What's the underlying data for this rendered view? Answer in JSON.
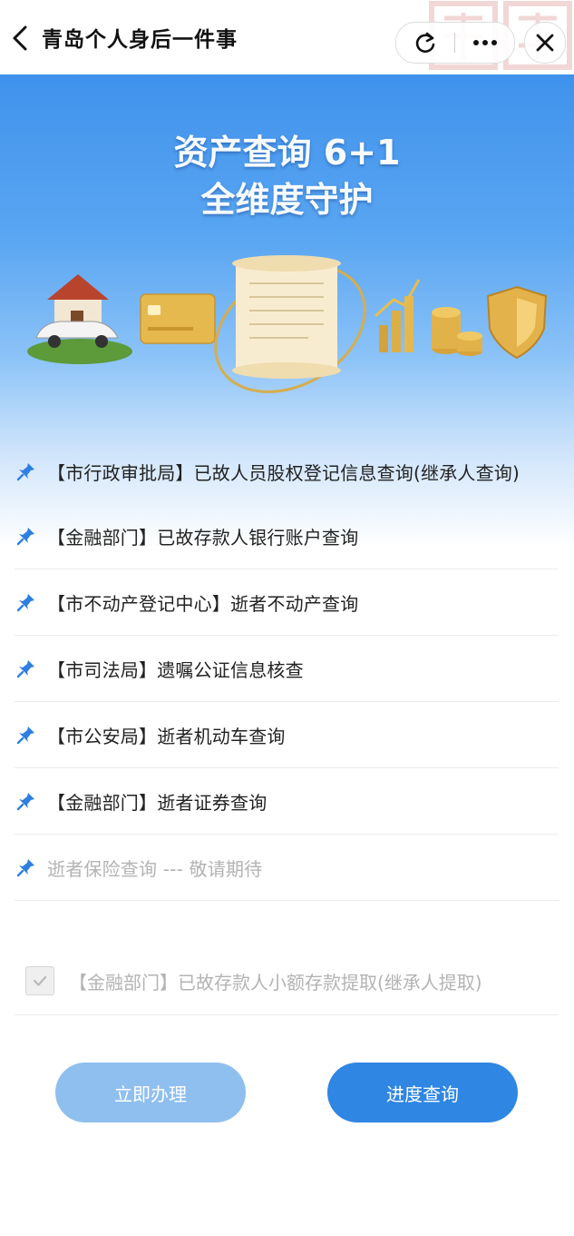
{
  "header": {
    "title": "青岛个人身后一件事",
    "back_icon": "chevron-left-icon",
    "refresh_icon": "refresh-icon",
    "more_icon": "more-dots-icon",
    "close_icon": "close-icon"
  },
  "banner": {
    "title_line1": "资产查询 6+1",
    "title_line2": "全维度守护",
    "colors": {
      "top": "#3f92ec",
      "bottom": "#ffffff"
    }
  },
  "services": [
    {
      "label": "【市行政审批局】已故人员股权登记信息查询(继承人查询)",
      "enabled": true
    },
    {
      "label": "【金融部门】已故存款人银行账户查询",
      "enabled": true
    },
    {
      "label": "【市不动产登记中心】逝者不动产查询",
      "enabled": true
    },
    {
      "label": "【市司法局】遗嘱公证信息核查",
      "enabled": true
    },
    {
      "label": "【市公安局】逝者机动车查询",
      "enabled": true
    },
    {
      "label": "【金融部门】逝者证券查询",
      "enabled": true
    },
    {
      "label": "逝者保险查询 --- 敬请期待",
      "enabled": false
    }
  ],
  "extra_service": {
    "label": "【金融部门】已故存款人小额存款提取(继承人提取)",
    "checked": true,
    "disabled": true
  },
  "actions": {
    "apply_label": "立即办理",
    "progress_label": "进度查询"
  },
  "colors": {
    "accent": "#2f86e3",
    "accent_light": "#8fbfef",
    "pin": "#2d7fe0",
    "muted_text": "#b3b3b3"
  }
}
